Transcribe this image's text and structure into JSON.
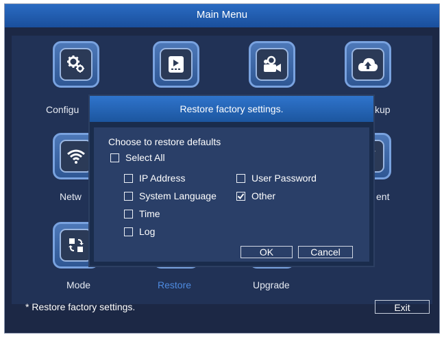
{
  "window": {
    "title": "Main Menu"
  },
  "menu": {
    "row1": [
      {
        "icon": "gears-icon",
        "label": "Configuration",
        "visible_label": "Configu"
      },
      {
        "icon": "playback-icon",
        "label": ""
      },
      {
        "icon": "video-camera-icon",
        "label": ""
      },
      {
        "icon": "cloud-upload-icon",
        "label": "Backup",
        "visible_label": "kup"
      }
    ],
    "row2": [
      {
        "icon": "wifi-icon",
        "label": "Network",
        "visible_label": "Netw"
      },
      {
        "icon": "alarm-icon",
        "label": "Event",
        "visible_label": "ent"
      }
    ],
    "row3": [
      {
        "icon": "mode-switch-icon",
        "label": "Mode"
      },
      {
        "icon": "restore-icon",
        "label": "Restore",
        "active": true
      },
      {
        "icon": "upgrade-icon",
        "label": "Upgrade"
      }
    ]
  },
  "status": {
    "text": "*  Restore factory settings."
  },
  "exit_button": "Exit",
  "dialog": {
    "title": "Restore factory settings.",
    "heading": "Choose to restore defaults",
    "select_all": {
      "label": "Select All",
      "checked": false
    },
    "options": [
      {
        "label": "IP Address",
        "checked": false
      },
      {
        "label": "User Password",
        "checked": false
      },
      {
        "label": "System Language",
        "checked": false
      },
      {
        "label": "Other",
        "checked": true
      },
      {
        "label": "Time",
        "checked": false
      },
      {
        "label": "Log",
        "checked": false
      }
    ],
    "ok_label": "OK",
    "cancel_label": "Cancel"
  },
  "colors": {
    "accent": "#2a6bc2",
    "active_label": "#4e8be0",
    "background": "#1c2845"
  }
}
